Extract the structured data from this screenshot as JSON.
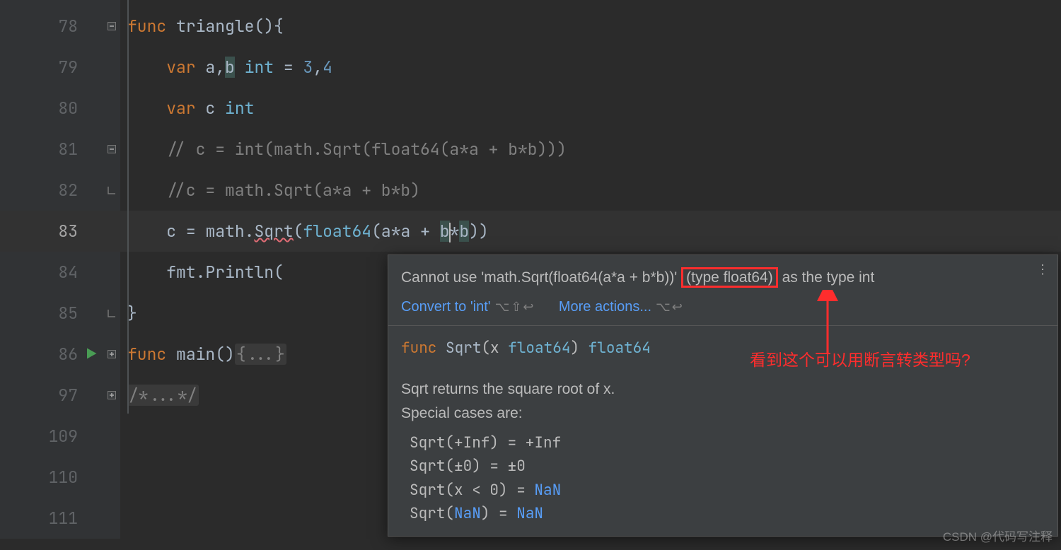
{
  "gutter": {
    "lines": [
      "78",
      "79",
      "80",
      "81",
      "82",
      "83",
      "84",
      "85",
      "86",
      "97",
      "109",
      "110",
      "111"
    ]
  },
  "code": {
    "l78": {
      "kw": "func",
      "name": "triangle",
      "paren": "(){"
    },
    "l79": {
      "kw": "var",
      "ids": "a",
      "comma": ",",
      "id2": "b",
      "type": "int",
      "eq": "=",
      "v1": "3",
      "c2": ",",
      "v2": "4"
    },
    "l80": {
      "kw": "var",
      "id": "c",
      "type": "int"
    },
    "l81": {
      "text": "// c = int(math.Sqrt(float64(a*a + b*b)))"
    },
    "l82": {
      "text": "//c = math.Sqrt(a*a + b*b)"
    },
    "l83": {
      "c": "c",
      "eq": "=",
      "pkg": "math",
      "dot": ".",
      "fn": "Sqrt",
      "op": "(",
      "cast": "float64",
      "op2": "(",
      "a": "a",
      "mul": "*",
      "a2": "a",
      "plus": "+",
      "b": "b",
      "mul2": "*",
      "b2": "b",
      "cl": ")",
      ")": ")"
    },
    "l84": {
      "fmt": "fmt",
      "dot": ".",
      "fn": "Println",
      "op": "("
    },
    "l85": {
      "brace": "}"
    },
    "l86": {
      "kw": "func",
      "name": "main",
      "paren": "()",
      "body": "{...}"
    },
    "l97": {
      "text": "/*...*/"
    }
  },
  "tooltip": {
    "err_pre": "Cannot use 'math.Sqrt(float64(a*a + b*b))' ",
    "err_boxed": "(type float64)",
    "err_post": " as the type int",
    "action1": "Convert to 'int'",
    "kbd1": "⌥⇧↩",
    "action2": "More actions...",
    "kbd2": "⌥↩",
    "sig_kw": "func",
    "sig_name": "Sqrt",
    "sig_paren_open": "(x ",
    "sig_t1": "float64",
    "sig_paren_close": ") ",
    "sig_t2": "float64",
    "doc1": "Sqrt returns the square root of x.",
    "doc2": "Special cases are:",
    "case1": "Sqrt(+Inf) = +Inf",
    "case2": "Sqrt(±0) = ±0",
    "case3_pre": "Sqrt(x < 0) = ",
    "case3_nan": "NaN",
    "case4_pre": "Sqrt(",
    "case4_nan1": "NaN",
    "case4_mid": ") = ",
    "case4_nan2": "NaN",
    "more": "⋮"
  },
  "annotation": {
    "text": "看到这个可以用断言转类型吗?"
  },
  "watermark": "CSDN @代码写注释"
}
